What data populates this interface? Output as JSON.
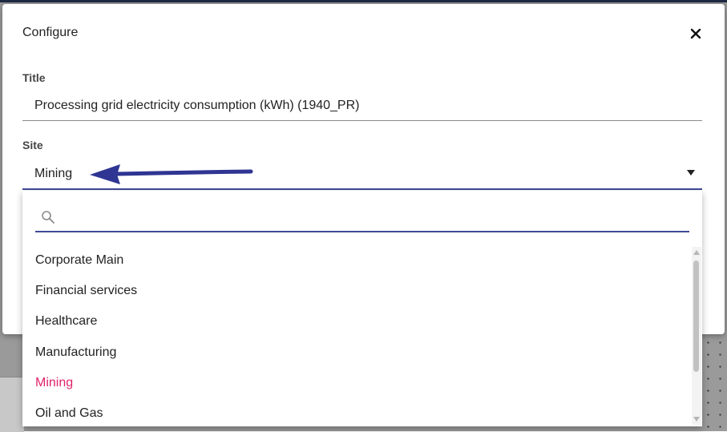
{
  "dialog": {
    "title": "Configure",
    "title_field": {
      "label": "Title",
      "value": "Processing grid electricity consumption (kWh) (1940_PR)"
    },
    "site_field": {
      "label": "Site",
      "value": "Mining"
    }
  },
  "dropdown": {
    "search_value": "",
    "options": [
      "Corporate Main",
      "Financial services",
      "Healthcare",
      "Manufacturing",
      "Mining",
      "Oil and Gas"
    ],
    "selected_option": "Mining"
  },
  "colors": {
    "accent": "#3f4a9a",
    "selected_text": "#e0246c",
    "annotation_arrow": "#2e3592"
  },
  "icons": {
    "close": "close-icon",
    "search": "search-icon",
    "dropdown": "chevron-down-icon"
  }
}
